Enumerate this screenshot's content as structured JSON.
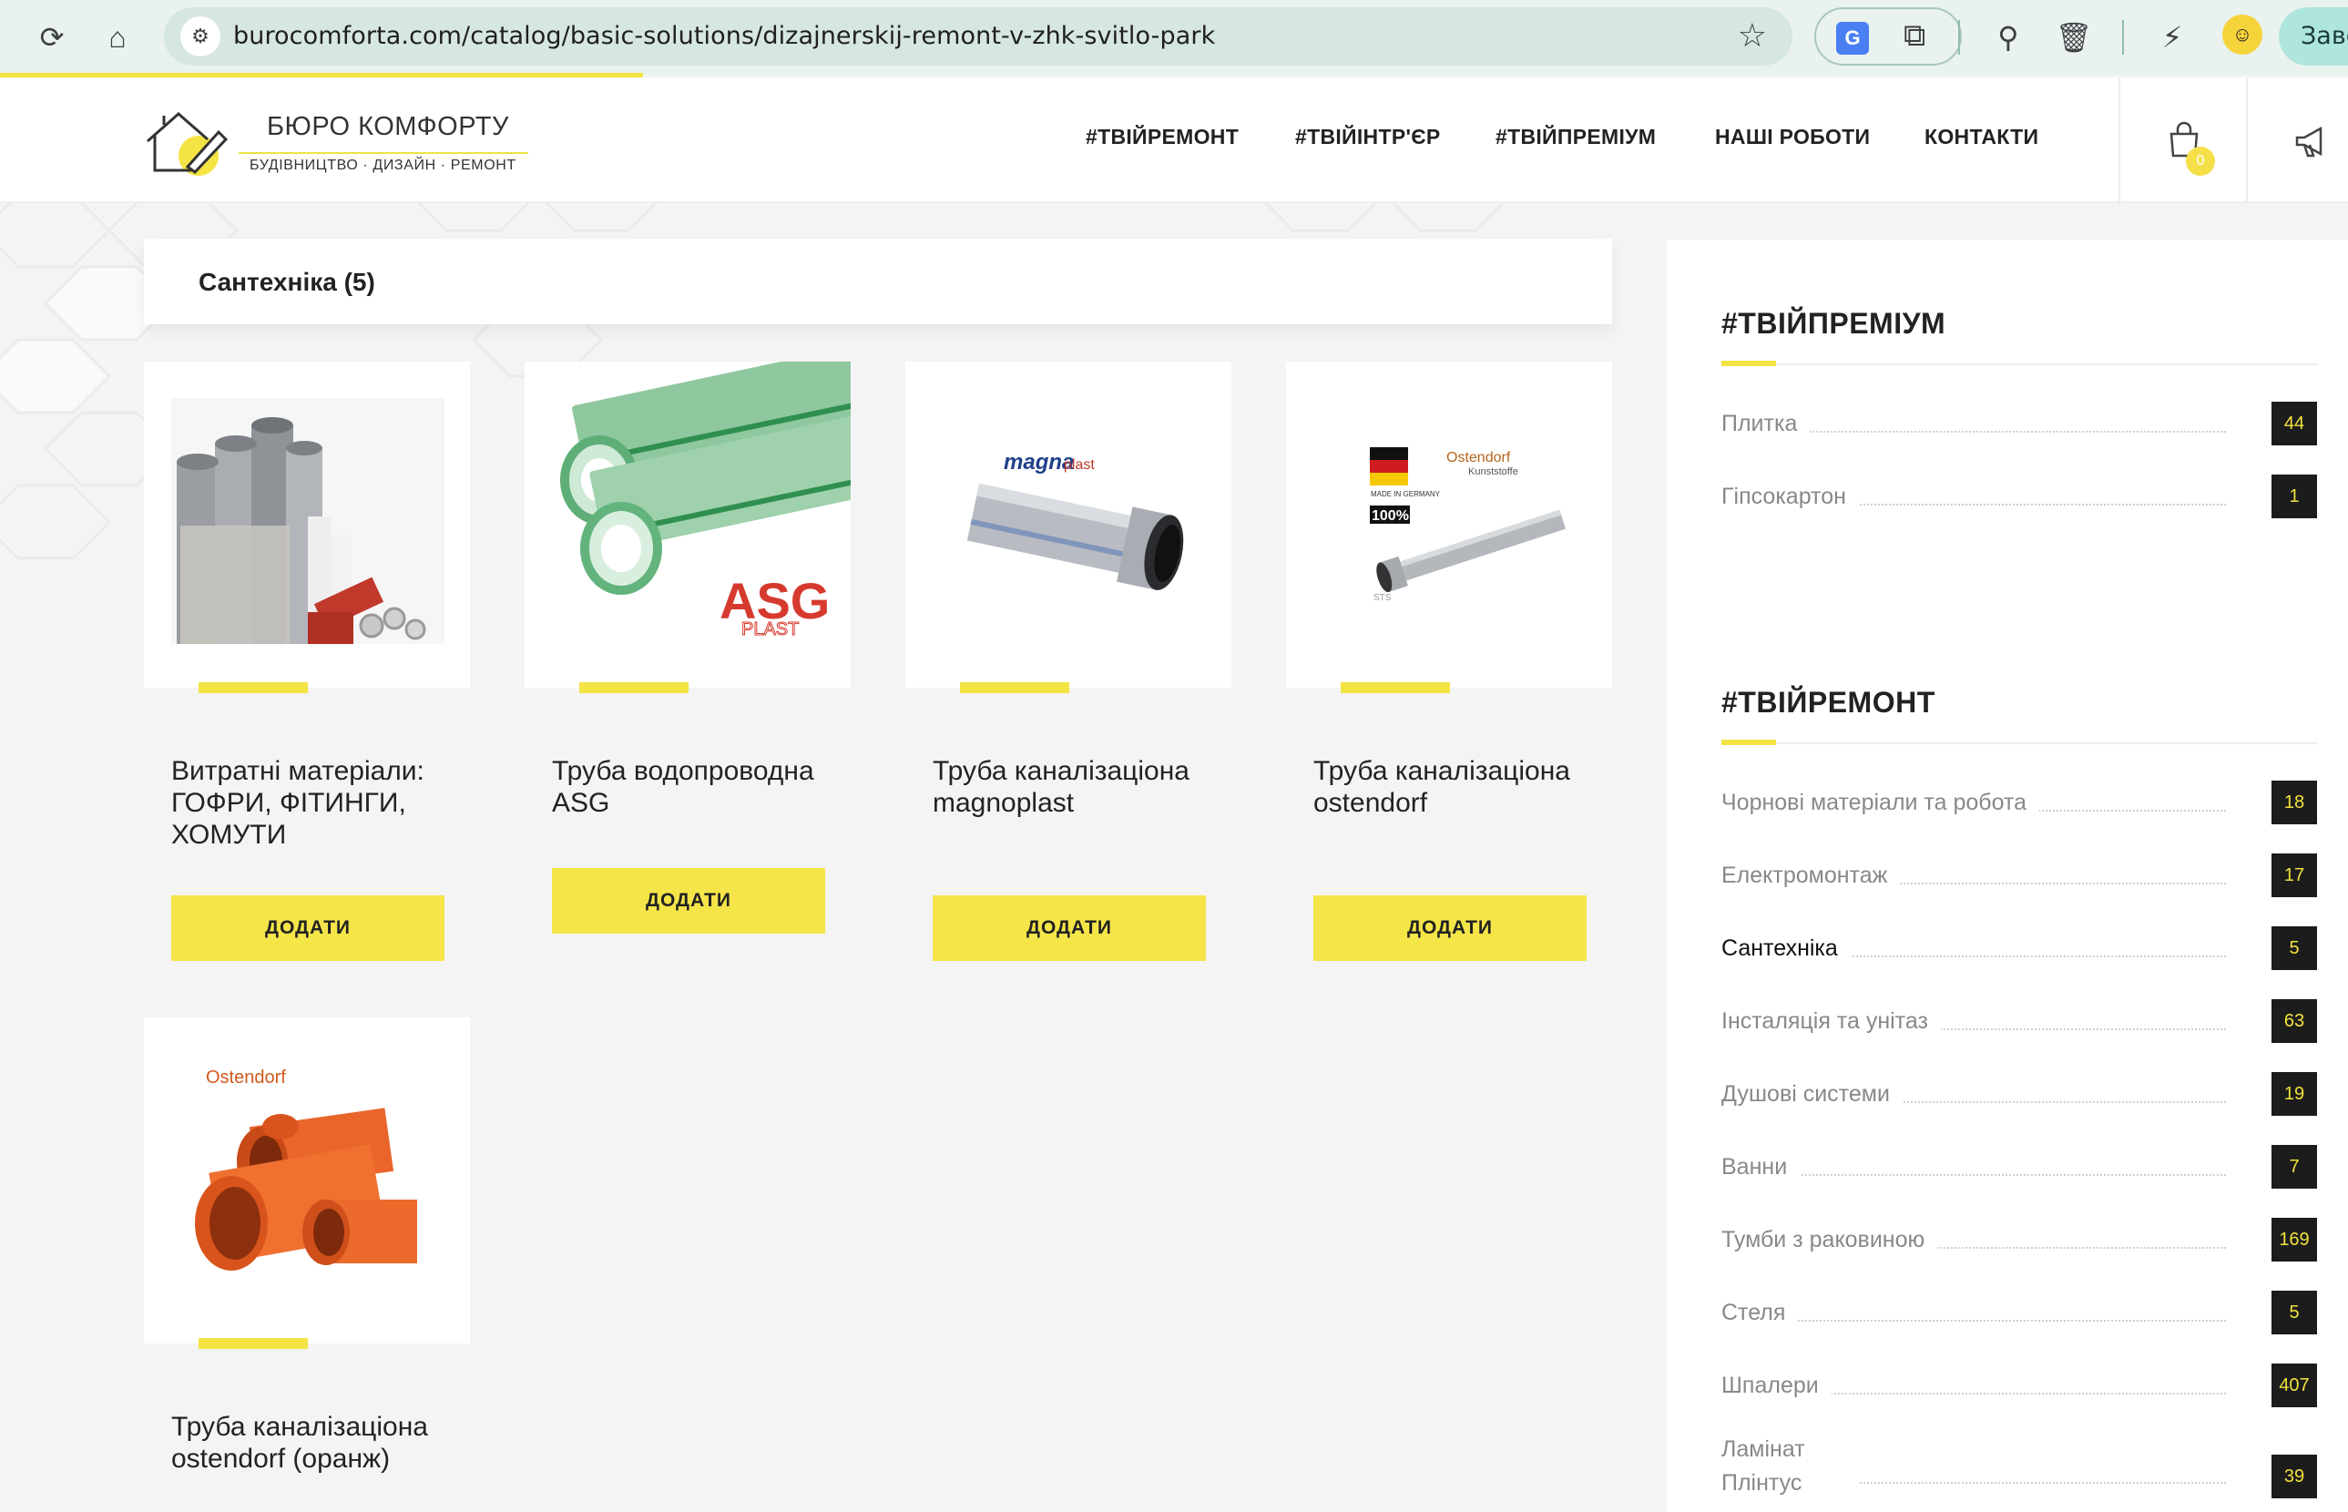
{
  "browser": {
    "url": "burocomforta.com/catalog/basic-solutions/dizajnerskij-remont-v-zhk-svitlo-park",
    "profile_label": "Заве"
  },
  "site": {
    "logo_title": "БЮРО КОМФОРТУ",
    "logo_sub": "БУДІВНИЦТВО  ·  ДИЗАЙН  ·  РЕМОНТ",
    "nav": [
      "#ТВІЙРЕМОНТ",
      "#ТВІЙІНТР'ЄР",
      "#ТВІЙПРЕМІУМ",
      "НАШІ РОБОТИ",
      "КОНТАКТИ"
    ],
    "cart_count": "0",
    "accent_color": "#f3e444"
  },
  "category": {
    "title": "Сантехніка (5)"
  },
  "products": [
    {
      "title": "Витратні матеріали: ГОФРИ, ФІТИНГИ, ХОМУТИ",
      "button": "ДОДАТИ"
    },
    {
      "title": "Труба водопроводна ASG",
      "button": "ДОДАТИ",
      "brand": "ASG",
      "brand_sub": "PLAST"
    },
    {
      "title": "Труба каналізаціона magnoplast",
      "button": "ДОДАТИ",
      "brand": "magna",
      "brand_sub": "plast"
    },
    {
      "title": "Труба каналізаціона ostendorf",
      "button": "ДОДАТИ",
      "brand": "Ostendorf",
      "brand_sub": "Kunststoffe",
      "badge": "100%",
      "badge_sub": "MADE IN GERMANY",
      "mark": "STS"
    },
    {
      "title": "Труба каналізаціона ostendorf (оранж)",
      "brand": "Ostendorf"
    }
  ],
  "sidebar": {
    "premium": {
      "heading": "#ТВІЙПРЕМІУМ",
      "items": [
        {
          "label": "Плитка",
          "count": "44"
        },
        {
          "label": "Гіпсокартон",
          "count": "1"
        }
      ]
    },
    "repair": {
      "heading": "#ТВІЙРЕМОНТ",
      "items": [
        {
          "label": "Чорнові матеріали та робота",
          "count": "18"
        },
        {
          "label": "Електромонтаж",
          "count": "17"
        },
        {
          "label": "Сантехніка",
          "count": "5"
        },
        {
          "label": "Інсталяція та унітаз",
          "count": "63"
        },
        {
          "label": "Душові системи",
          "count": "19"
        },
        {
          "label": "Ванни",
          "count": "7"
        },
        {
          "label": "Тумби з раковиною",
          "count": "169"
        },
        {
          "label": "Стеля",
          "count": "5"
        },
        {
          "label": "Шпалери",
          "count": "407"
        },
        {
          "label": "Ламінат Плінтус",
          "count": "39"
        }
      ]
    }
  }
}
